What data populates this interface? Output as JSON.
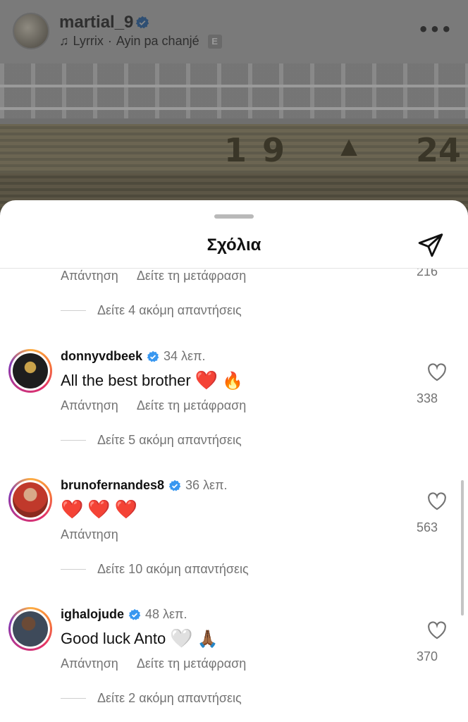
{
  "post": {
    "username": "martial_9",
    "music": {
      "artist": "Lyrrix",
      "separator": "·",
      "song": "Ayin pa chanjé",
      "explicit_badge": "E"
    },
    "more_icon": "ellipsis-icon",
    "stand_digits_left": "19",
    "stand_digits_right": "24"
  },
  "sheet": {
    "title": "Σχόλια",
    "share_icon": "paper-plane-icon"
  },
  "labels": {
    "reply": "Απάντηση",
    "translate": "Δείτε τη μετάφραση"
  },
  "partial_comment": {
    "likes": "216",
    "view_more": "Δείτε 4 ακόμη απαντήσεις"
  },
  "comments": [
    {
      "username": "donnyvdbeek",
      "verified": true,
      "time": "34 λεπ.",
      "text": "All the best brother",
      "emojis": [
        "❤️",
        "🔥"
      ],
      "likes": "338",
      "has_translate": true,
      "view_more": "Δείτε 5 ακόμη απαντήσεις"
    },
    {
      "username": "brunofernandes8",
      "verified": true,
      "time": "36 λεπ.",
      "text": "",
      "emojis": [
        "❤️",
        "❤️",
        "❤️"
      ],
      "likes": "563",
      "has_translate": false,
      "view_more": "Δείτε 10 ακόμη απαντήσεις"
    },
    {
      "username": "ighalojude",
      "verified": true,
      "time": "48 λεπ.",
      "text": "Good luck Anto",
      "emojis": [
        "🤍",
        "🙏🏾"
      ],
      "likes": "370",
      "has_translate": true,
      "view_more": "Δείτε 2 ακόμη απαντήσεις"
    }
  ],
  "colors": {
    "verified": "#3897f0",
    "secondary_text": "#737373",
    "heart_red": "#e0102a"
  }
}
